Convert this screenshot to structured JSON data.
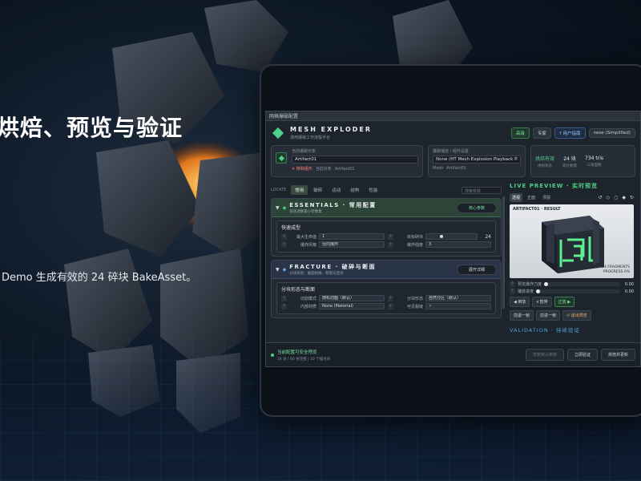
{
  "hero": {
    "title": "烘焙、预览与验证",
    "subtitle": "Demo 生成有效的 24 碎块 BakeAsset。"
  },
  "window": {
    "title": "网格爆破配置",
    "app_name": "MESH EXPLODER",
    "app_sub": "通用爆破工作流程平台",
    "header_buttons": [
      "高级",
      "专家",
      "? 用户指南",
      "nese (Simplified)"
    ]
  },
  "asset_card": {
    "label": "当前爆破对象",
    "value": "Artifact01",
    "remove_label": "✕ 移除组件",
    "link_label": "当前对象",
    "link_value": "Artifact01"
  },
  "playback_card": {
    "label": "爆破播放 / 组件设置",
    "value": "None (HT Mesh Explosion Playback Profi",
    "mesh_label": "Mesh",
    "mesh_value": "Artifact01"
  },
  "stats": [
    {
      "value": "烘焙有效",
      "sub": "烘焙状态",
      "tone": "green"
    },
    {
      "value": "24 块",
      "sub": "碎片数量",
      "tone": "white"
    },
    {
      "value": "734 tris",
      "sub": "三角面数",
      "tone": "white"
    }
  ],
  "tabs": {
    "locate": "LOCATE",
    "items": [
      "常用",
      "破碎",
      "运动",
      "结构",
      "性能"
    ],
    "active": 0,
    "search_placeholder": "搜索参数"
  },
  "essentials": {
    "title": "ESSENTIALS · 常用配置",
    "sub": "快速调整最小参数集",
    "button": "核心参数",
    "group_title": "快速成型",
    "rows": [
      {
        "k1": "最大生命值",
        "v1": "1",
        "k2": "目标碎块",
        "v2": "24",
        "slider": 0.3
      },
      {
        "k1": "爆炸风格",
        "v1": "径向爆炸",
        "k2": "爆炸强度",
        "v2": "3"
      }
    ]
  },
  "fracture": {
    "title": "FRACTURE · 破碎与断面",
    "sub": "分块形状、截面材质、断裂与变形",
    "button": "展开详细",
    "group_title": "分块形态与断面",
    "rows": [
      {
        "k1": "切割模式",
        "v1": "随机切面（默认）",
        "k2": "分块形态",
        "v2": "自然分区（默认）"
      },
      {
        "k1": "内部材质",
        "v1": "None (Material)",
        "k2": "可见裂缝",
        "v2": "✓"
      }
    ]
  },
  "footer": {
    "status": "当前配置可安全预览",
    "detail": "24 块 | 60 条连接 | 10 个锚点块",
    "buttons": [
      "恢复默认参数",
      "立即验证",
      "烘焙并更新"
    ]
  },
  "preview": {
    "title": "LIVE PREVIEW · 实时预览",
    "tabs": [
      "透视",
      "正面",
      "顶视"
    ],
    "active_tab": 0,
    "icons": [
      "rotate-left-icon",
      "diamond-icon",
      "circle-icon",
      "diamond-fill-icon",
      "refresh-icon"
    ],
    "viewport_label": "ARTIFACT01 · RESULT",
    "info_lines": [
      "24 FRAGMENTS",
      "PROGRESS 0%"
    ],
    "sliders": [
      {
        "label": "预览爆炸力度",
        "value": "0.00",
        "fraction": 0.0
      },
      {
        "label": "播放进度",
        "value": "0.00",
        "fraction": 0.0
      }
    ],
    "controls_row1": [
      "◀ 倒放",
      "⏸ 暂停",
      "正放 ▶"
    ],
    "controls_row2": [
      "前退一帧",
      "前进一帧",
      "↺ 退出预览"
    ],
    "validation": "VALIDATION · 持续验证"
  }
}
